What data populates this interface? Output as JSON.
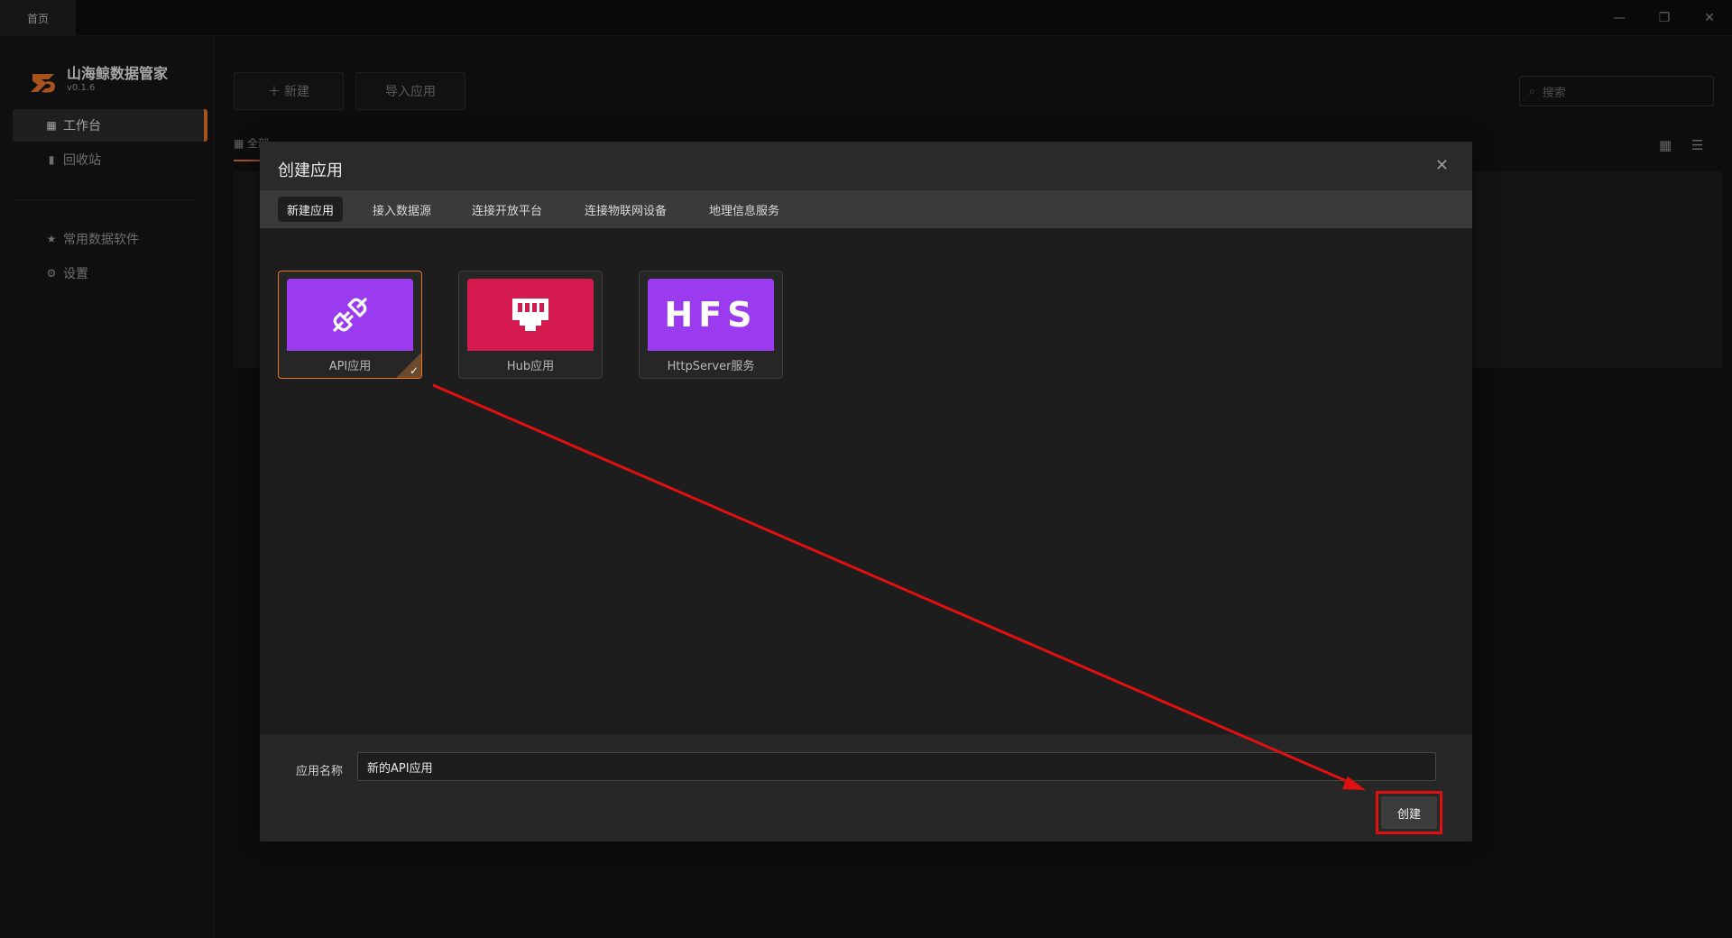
{
  "titlebar": {
    "tab_label": "首页"
  },
  "sidebar": {
    "brand_name": "山海鲸数据管家",
    "brand_version": "v0.1.6",
    "items": [
      {
        "label": "工作台",
        "icon": "grid-icon",
        "active": true
      },
      {
        "label": "回收站",
        "icon": "trash-icon",
        "active": false
      },
      {
        "label": "常用数据软件",
        "icon": "star-icon",
        "active": false
      },
      {
        "label": "设置",
        "icon": "gear-icon",
        "active": false
      }
    ]
  },
  "main": {
    "new_label": "新建",
    "import_label": "导入应用",
    "search_placeholder": "搜索",
    "filter_tab_all": "全部"
  },
  "modal": {
    "title": "创建应用",
    "tabs": [
      "新建应用",
      "接入数据源",
      "连接开放平台",
      "连接物联网设备",
      "地理信息服务"
    ],
    "cards": [
      {
        "label": "API应用",
        "color": "#9b3bf0",
        "icon": "plug-icon",
        "selected": true
      },
      {
        "label": "Hub应用",
        "color": "#d41a4f",
        "icon": "hub-icon",
        "selected": false
      },
      {
        "label": "HttpServer服务",
        "color": "#9b3bf0",
        "icon_text": "HFS",
        "selected": false
      }
    ],
    "name_label": "应用名称",
    "name_value": "新的API应用",
    "create_label": "创建"
  },
  "colors": {
    "accent": "#e8742a",
    "annotation": "#e01010"
  }
}
